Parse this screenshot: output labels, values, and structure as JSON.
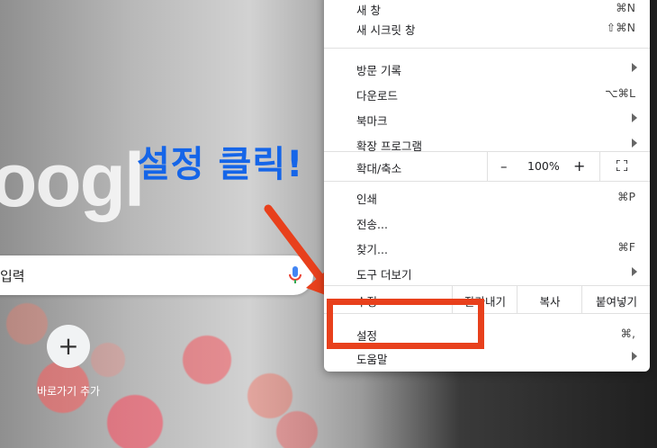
{
  "ntp": {
    "logo_text": "oogl",
    "search_placeholder": "입력",
    "shortcut_plus": "+",
    "shortcut_label": "바로가기 추가"
  },
  "annotation": {
    "callout_text": "설정 클릭!",
    "arrow_color": "#e8401c",
    "text_color": "#1565e8"
  },
  "menu": {
    "top_items": [
      {
        "label": "새 창",
        "shortcut": "⌘N"
      },
      {
        "label": "새 시크릿 창",
        "shortcut": "⇧⌘N"
      }
    ],
    "group2": [
      {
        "label": "방문 기록",
        "submenu": true
      },
      {
        "label": "다운로드",
        "shortcut": "⌥⌘L"
      },
      {
        "label": "북마크",
        "submenu": true
      },
      {
        "label": "확장 프로그램",
        "submenu": true
      }
    ],
    "zoom": {
      "label": "확대/축소",
      "minus": "–",
      "value": "100%",
      "plus": "+"
    },
    "group3": [
      {
        "label": "인쇄",
        "shortcut": "⌘P"
      },
      {
        "label": "전송...",
        "shortcut": ""
      },
      {
        "label": "찾기...",
        "shortcut": "⌘F"
      },
      {
        "label": "도구 더보기",
        "submenu": true
      }
    ],
    "edit": {
      "label": "수정",
      "cut": "잘라내기",
      "copy": "복사",
      "paste": "붙여넣기"
    },
    "settings": {
      "label": "설정",
      "shortcut": "⌘,"
    },
    "help": {
      "label": "도움말",
      "submenu": true
    }
  }
}
